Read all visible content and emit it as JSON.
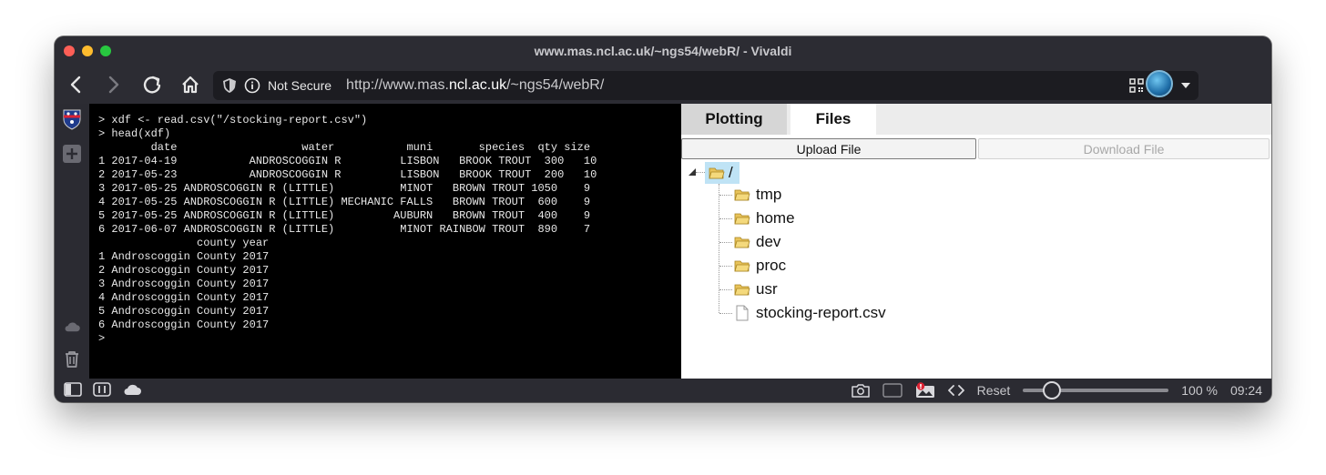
{
  "window": {
    "title": "www.mas.ncl.ac.uk/~ngs54/webR/ - Vivaldi"
  },
  "addressbar": {
    "security_label": "Not Secure",
    "url_prefix": "http://www.mas.",
    "url_domain": "ncl.ac.uk",
    "url_suffix": "/~ngs54/webR/"
  },
  "console": {
    "lines": [
      "> xdf <- read.csv(\"/stocking-report.csv\")",
      "> head(xdf)",
      "        date                   water           muni       species  qty size",
      "1 2017-04-19           ANDROSCOGGIN R         LISBON   BROOK TROUT  300   10",
      "2 2017-05-23           ANDROSCOGGIN R         LISBON   BROOK TROUT  200   10",
      "3 2017-05-25 ANDROSCOGGIN R (LITTLE)          MINOT   BROWN TROUT 1050    9",
      "4 2017-05-25 ANDROSCOGGIN R (LITTLE) MECHANIC FALLS   BROWN TROUT  600    9",
      "5 2017-05-25 ANDROSCOGGIN R (LITTLE)         AUBURN   BROWN TROUT  400    9",
      "6 2017-06-07 ANDROSCOGGIN R (LITTLE)          MINOT RAINBOW TROUT  890    7",
      "               county year",
      "1 Androscoggin County 2017",
      "2 Androscoggin County 2017",
      "3 Androscoggin County 2017",
      "4 Androscoggin County 2017",
      "5 Androscoggin County 2017",
      "6 Androscoggin County 2017",
      ">"
    ]
  },
  "panel": {
    "tabs": [
      "Plotting",
      "Files"
    ],
    "active_tab": "Files",
    "upload_label": "Upload File",
    "download_label": "Download File"
  },
  "files": {
    "root": "/",
    "folders": [
      "tmp",
      "home",
      "dev",
      "proc",
      "usr"
    ],
    "file": "stocking-report.csv"
  },
  "statusbar": {
    "reset_label": "Reset",
    "zoom_percent": 100,
    "zoom_label": "100 %",
    "time": "09:24"
  },
  "colors": {
    "chrome": "#2c2c33",
    "console_bg": "#000000",
    "selected_tree": "#bfe3f5",
    "folder": "#e8c35a"
  }
}
